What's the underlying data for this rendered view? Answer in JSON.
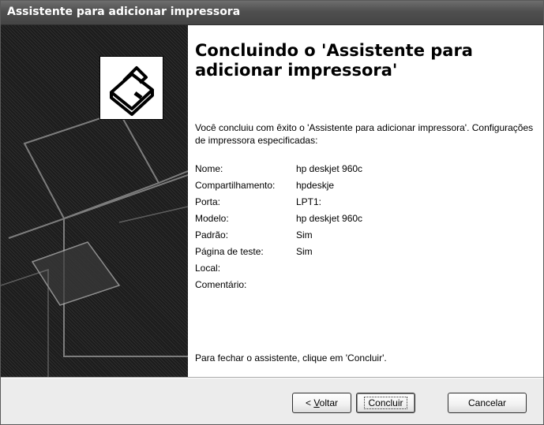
{
  "window": {
    "title": "Assistente para adicionar impressora"
  },
  "side_panel": {
    "icon": "printer-icon"
  },
  "main": {
    "heading": "Concluindo o 'Assistente para adicionar impressora'",
    "intro": "Você concluiu com êxito o 'Assistente para adicionar impressora'. Configurações de impressora especificadas:",
    "properties": [
      {
        "label": "Nome:",
        "value": "hp deskjet 960c"
      },
      {
        "label": "Compartilhamento:",
        "value": "hpdeskje"
      },
      {
        "label": "Porta:",
        "value": "LPT1:"
      },
      {
        "label": "Modelo:",
        "value": "hp deskjet 960c"
      },
      {
        "label": "Padrão:",
        "value": "Sim"
      },
      {
        "label": "Página de teste:",
        "value": "Sim"
      },
      {
        "label": "Local:",
        "value": ""
      },
      {
        "label": "Comentário:",
        "value": ""
      }
    ],
    "closing": "Para fechar o assistente, clique em 'Concluir'."
  },
  "buttons": {
    "back_prefix": "< ",
    "back_mnemonic": "V",
    "back_rest": "oltar",
    "finish": "Concluir",
    "cancel": "Cancelar"
  }
}
